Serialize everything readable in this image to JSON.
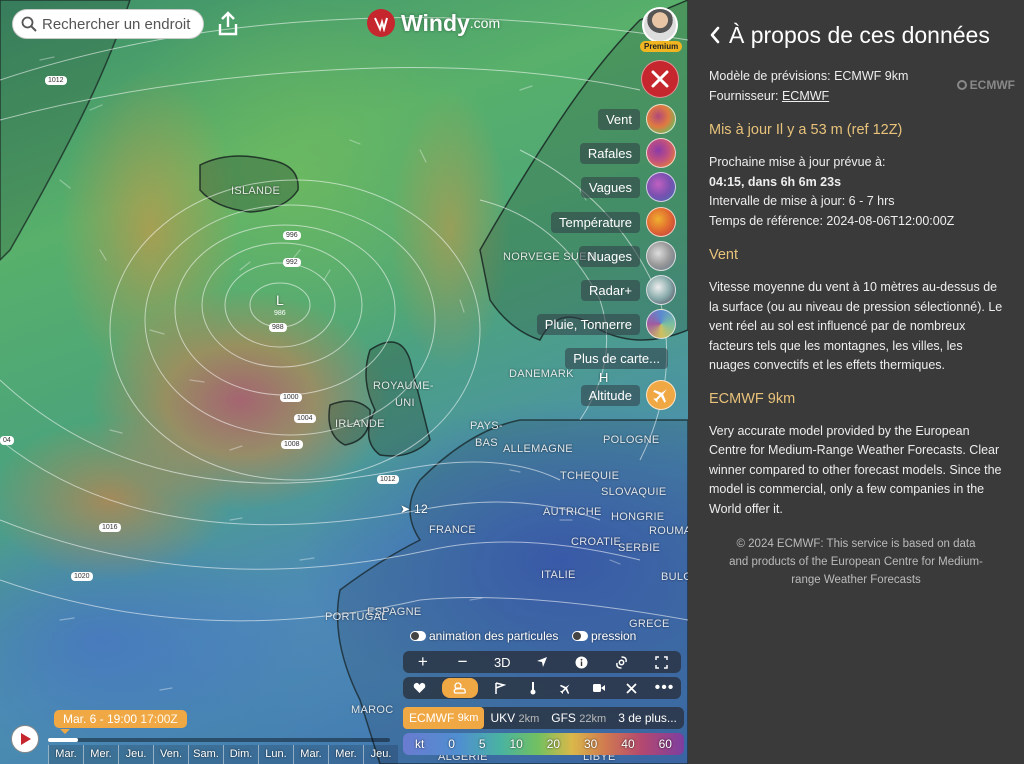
{
  "search": {
    "placeholder": "Rechercher un endroit"
  },
  "logo": {
    "name": "Windy",
    "tld": ".com"
  },
  "user": {
    "badge": "Premium"
  },
  "map": {
    "places": [
      "ISLANDE",
      "NORVEGE SUED",
      "ROYAUME-",
      "UNI",
      "IRLANDE",
      "DANEMARK",
      "PAYS-",
      "BAS",
      "ALLEMAGNE",
      "POLOGNE",
      "TCHEQUIE",
      "SLOVAQUIE",
      "AUTRICHE",
      "HONGRIE",
      "ROUMA",
      "FRANCE",
      "CROATIE",
      "SERBIE",
      "ITALIE",
      "BULG",
      "ESPAGNE",
      "PORTUGAL",
      "GRECE",
      "MAROC",
      "ALGERIE",
      "LIBYE"
    ],
    "isobars": [
      "1012",
      "996",
      "992",
      "986",
      "988",
      "1000",
      "1004",
      "1008",
      "1012",
      "1016",
      "1020",
      "04"
    ],
    "low_marker": "L",
    "high_marker": "H",
    "wind_marker": "12"
  },
  "layers": [
    {
      "label": "Vent",
      "icon": "wind-icon"
    },
    {
      "label": "Rafales",
      "icon": "gusts-icon"
    },
    {
      "label": "Vagues",
      "icon": "waves-icon"
    },
    {
      "label": "Température",
      "icon": "temperature-icon"
    },
    {
      "label": "Nuages",
      "icon": "clouds-icon"
    },
    {
      "label": "Radar+",
      "icon": "radar-icon"
    },
    {
      "label": "Pluie, Tonnerre",
      "icon": "rain-icon"
    },
    {
      "label": "Plus de carte...",
      "icon": ""
    },
    {
      "label": "Altitude",
      "icon": "plane-icon"
    }
  ],
  "toggles": {
    "particles": "animation des particules",
    "pressure": "pression"
  },
  "tools": {
    "zoom_in": "+",
    "zoom_out": "−",
    "view3d": "3D"
  },
  "models": [
    {
      "name": "ECMWF",
      "res": "9km",
      "selected": true
    },
    {
      "name": "UKV",
      "res": "2km",
      "selected": false
    },
    {
      "name": "GFS",
      "res": "22km",
      "selected": false
    },
    {
      "name": "3 de plus...",
      "res": "",
      "selected": false
    }
  ],
  "scale": {
    "unit": "kt",
    "values": [
      "0",
      "5",
      "10",
      "20",
      "30",
      "40",
      "60"
    ]
  },
  "timeline": {
    "current": "Mar. 6 - 19:00",
    "zulu": "17:00Z",
    "days": [
      "Mar.",
      "Mer.",
      "Jeu.",
      "Ven.",
      "Sam.",
      "Dim.",
      "Lun.",
      "Mar.",
      "Mer.",
      "Jeu."
    ]
  },
  "panel": {
    "title": "À propos de ces données",
    "model_line": "Modèle de prévisions: ECMWF 9km",
    "provider_label": "Fournisseur:",
    "provider": "ECMWF",
    "logo_text": "ECMWF",
    "updated": "Mis à jour Il y a 53 m (ref 12Z)",
    "next_update_label": "Prochaine mise à jour prévue à:",
    "next_update": "04:15,  dans 6h 6m 23s",
    "interval": "Intervalle de mise à jour: 6 - 7 hrs",
    "ref_time": "Temps de référence: 2024-08-06T12:00:00Z",
    "wind_head": "Vent",
    "wind_text": "Vitesse moyenne du vent à 10 mètres au-dessus de la surface (ou au niveau de pression sélectionné). Le vent réel au sol est influencé par de nombreux facteurs tels que les montagnes, les villes, les nuages convectifs et les effets thermiques.",
    "model_head": "ECMWF 9km",
    "model_text": "Very accurate model provided by the European Centre for Medium-Range Weather Forecasts. Clear winner compared to other forecast models. Since the model is commercial, only a few companies in the World offer it.",
    "footer": "© 2024 ECMWF: This service is based on data and products of the European Centre for Medium-range Weather Forecasts"
  },
  "colors": {
    "accent": "#f0a845",
    "brand_red": "#c6262e",
    "panel_bg": "#3a3a3a",
    "heading": "#e8c27a"
  }
}
